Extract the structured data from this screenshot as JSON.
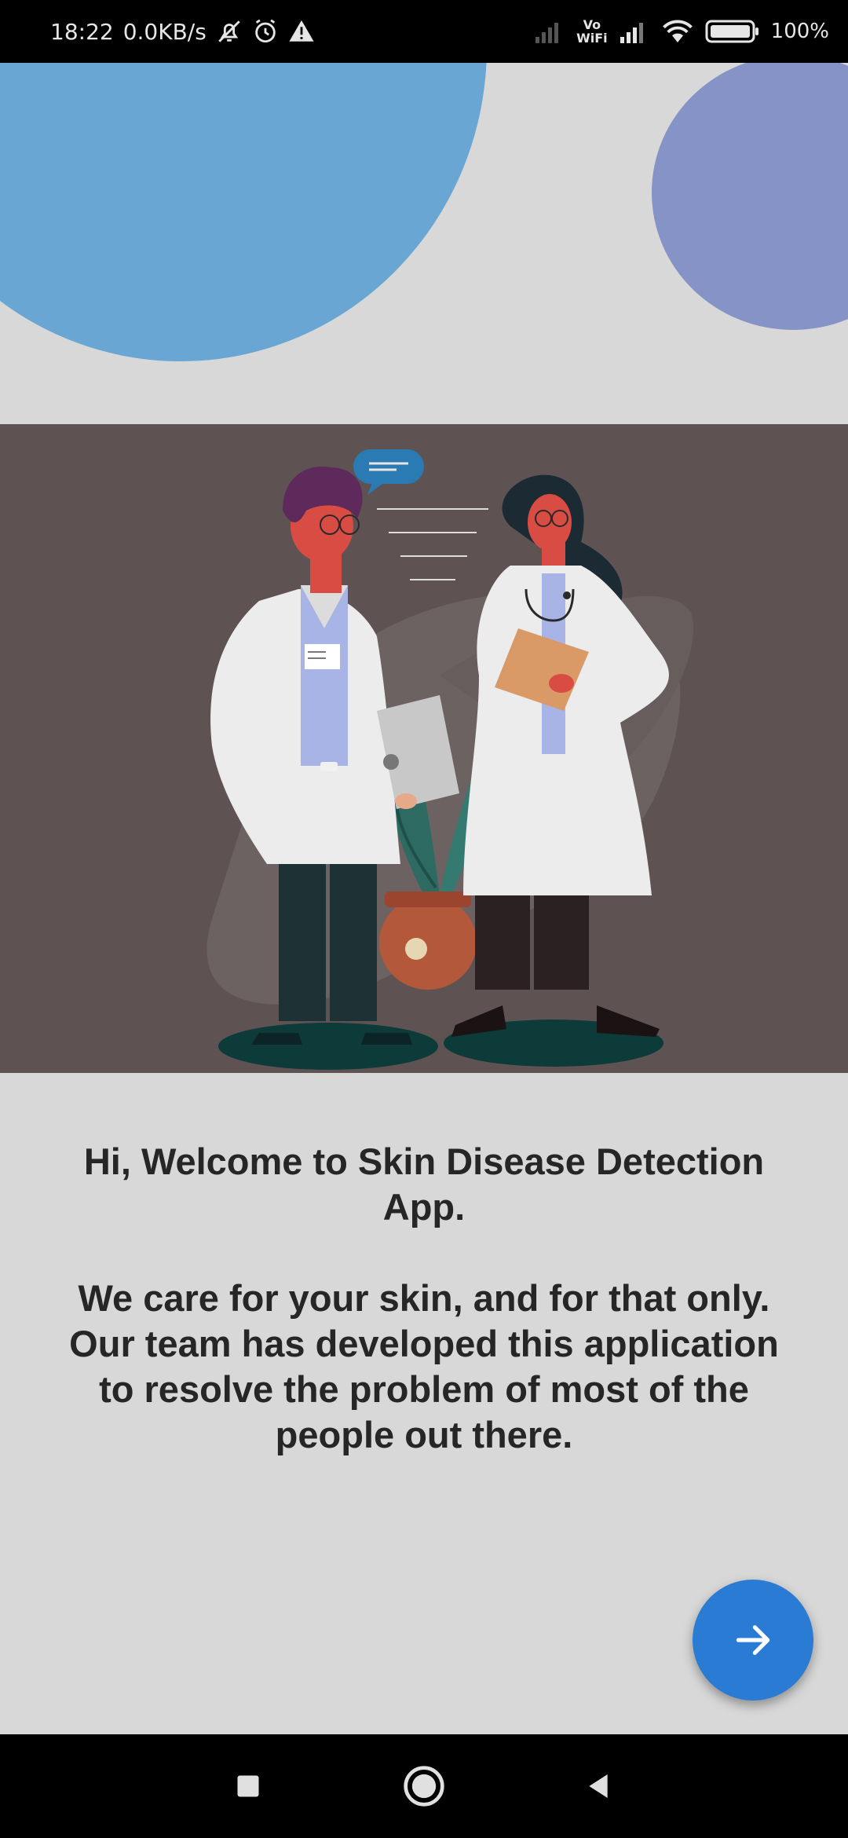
{
  "status_bar": {
    "time": "18:22",
    "net_speed": "0.0KB/s",
    "battery": "100%",
    "vowifi_top": "Vo",
    "vowifi_bottom": "WiFi",
    "icons": [
      "mute-bell-icon",
      "alarm-icon",
      "warning-icon",
      "signal-icon",
      "vowifi-icon",
      "signal-icon",
      "wifi-icon",
      "battery-icon"
    ]
  },
  "colors": {
    "background": "#d8d8d8",
    "circle_blue": "#6aa6d3",
    "circle_purple": "#8593c6",
    "illustration_bg": "#5e5352",
    "fab": "#2a7bd4",
    "text": "#262626"
  },
  "welcome": {
    "title": "Hi, Welcome to Skin Disease Detection App.",
    "body": "We care for your skin, and for that only. Our team has developed this application to resolve the problem of most of the people out there."
  },
  "fab": {
    "icon": "arrow-right-icon"
  },
  "nav_bar": {
    "icons": [
      "recents-square-icon",
      "home-circle-icon",
      "back-triangle-icon"
    ]
  }
}
